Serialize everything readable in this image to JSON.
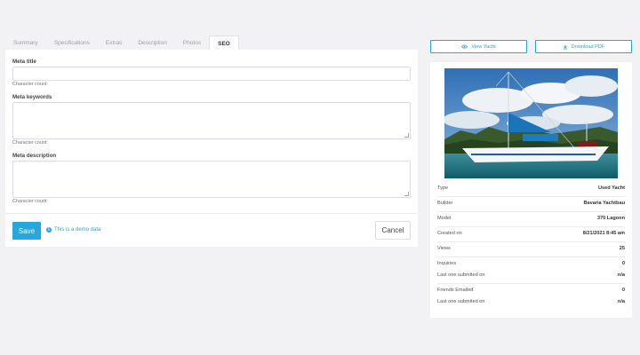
{
  "tabs": [
    "Summary",
    "Specifications",
    "Extras",
    "Description",
    "Photos",
    "SEO"
  ],
  "form": {
    "meta_title_label": "Meta title",
    "meta_keywords_label": "Meta keywords",
    "meta_description_label": "Meta description",
    "char_count_label": "Character count:",
    "save_label": "Save",
    "demo_note": "This is a demo data",
    "cancel_label": "Cancel"
  },
  "actions": {
    "view_label": "View Yacht",
    "pdf_label": "Download PDF"
  },
  "details": {
    "type_k": "Type",
    "type_v": "Used Yacht",
    "builder_k": "Builder",
    "builder_v": "Bavaria Yachtbau",
    "model_k": "Model",
    "model_v": "370 Lagoon",
    "created_k": "Created on",
    "created_v": "8/21/2021 8:45 am",
    "views_k": "Views",
    "views_v": "25",
    "inq_k": "Inquiries",
    "inq_v": "0",
    "inq_last_k": "Last one submited on",
    "inq_last_v": "n/a",
    "friends_k": "Friends Emailed",
    "friends_v": "0",
    "friends_last_k": "Last one submited on",
    "friends_last_v": "n/a"
  },
  "colors": {
    "accent": "#26a8df",
    "background": "#f2f2f4"
  },
  "icons": {
    "view": "eye-icon",
    "pdf": "download-icon",
    "info": "info-icon"
  }
}
